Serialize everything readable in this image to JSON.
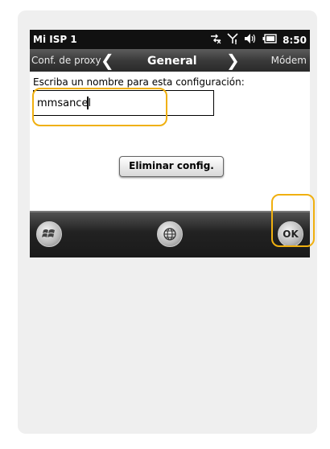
{
  "status": {
    "title": "Mi ISP 1",
    "time": "8:50",
    "icons": [
      "data-connection-icon",
      "signal-icon",
      "volume-icon",
      "battery-icon"
    ]
  },
  "nav": {
    "left_label": "Conf. de proxy",
    "center_label": "General",
    "right_label": "Módem"
  },
  "form": {
    "prompt": "Escriba un nombre para esta configuración:",
    "name_value": "mmsancel"
  },
  "buttons": {
    "delete_label": "Eliminar config.",
    "ok_label": "OK"
  },
  "softkeys": [
    "windows-start-icon",
    "globe-icon",
    "ok-button"
  ],
  "colors": {
    "highlight": "#f0b010",
    "card_bg": "#efefef"
  }
}
